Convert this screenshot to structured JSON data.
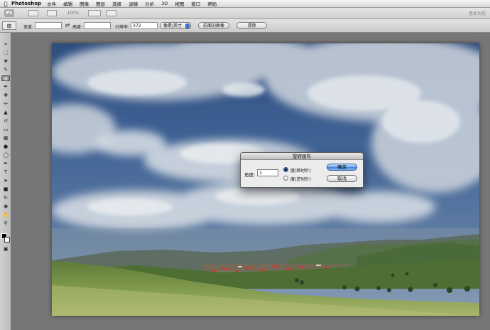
{
  "menubar": {
    "app_name": "Photoshop",
    "items": [
      "文件",
      "编辑",
      "图像",
      "图层",
      "选择",
      "滤镜",
      "分析",
      "3D",
      "视图",
      "窗口",
      "帮助"
    ]
  },
  "appbar": {
    "logo": "Ps",
    "zoom": "100%",
    "workspace": "基本功能"
  },
  "options": {
    "width_label": "宽度:",
    "width_value": "",
    "height_label": "高度:",
    "height_value": "",
    "resolution_label": "分辨率:",
    "resolution_value": "372",
    "unit_select": "像素/英寸",
    "front_image_button": "前面的图像",
    "clear_button": "清除"
  },
  "dialog": {
    "title": "旋转画布",
    "angle_label": "角度:",
    "angle_value": "1",
    "option_cw": "度(顺时针)",
    "option_ccw": "度(逆时针)",
    "selected": "cw",
    "ok_button": "确定",
    "cancel_button": "取消"
  },
  "colors": {
    "accent": "#3f7fdc",
    "foreground_color": "#000000",
    "background_color": "#ffffff"
  }
}
